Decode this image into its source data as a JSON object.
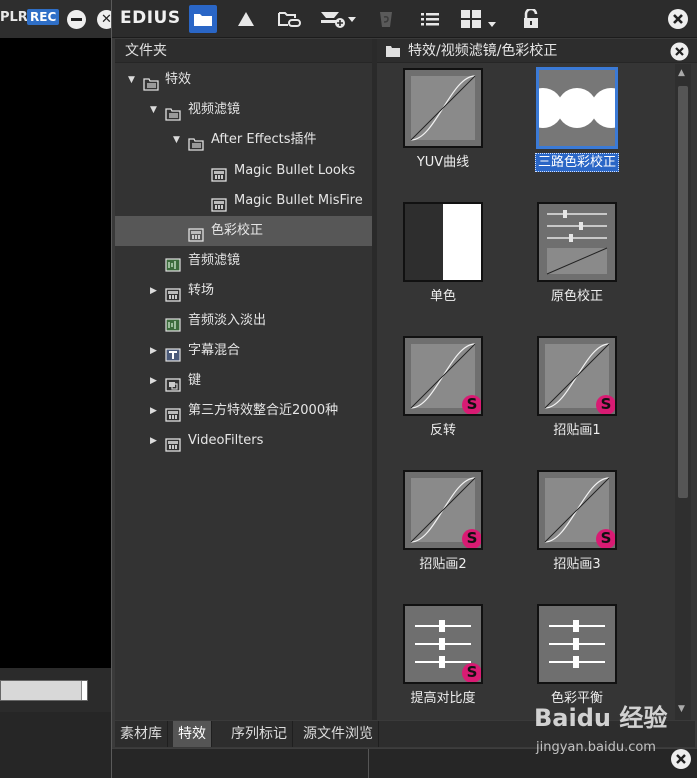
{
  "background_app": {
    "plr_label": "PLR",
    "rec_label": "REC"
  },
  "toolbar": {
    "logo": "EDIUS"
  },
  "tree": {
    "header": "文件夹",
    "items": [
      {
        "label": "特效",
        "arrow": "▼"
      },
      {
        "label": "视频滤镜",
        "arrow": "▼"
      },
      {
        "label": "After Effects插件",
        "arrow": "▼"
      },
      {
        "label": "Magic Bullet Looks",
        "arrow": ""
      },
      {
        "label": "Magic Bullet MisFire",
        "arrow": ""
      },
      {
        "label": "色彩校正",
        "arrow": ""
      },
      {
        "label": "音频滤镜",
        "arrow": ""
      },
      {
        "label": "转场",
        "arrow": "▶"
      },
      {
        "label": "音频淡入淡出",
        "arrow": ""
      },
      {
        "label": "字幕混合",
        "arrow": "▶"
      },
      {
        "label": "键",
        "arrow": "▶"
      },
      {
        "label": "第三方特效整合近2000种",
        "arrow": "▶"
      },
      {
        "label": "VideoFilters",
        "arrow": "▶"
      }
    ]
  },
  "grid": {
    "path": "特效/视频滤镜/色彩校正",
    "tiles": [
      {
        "label": "YUV曲线",
        "badge": ""
      },
      {
        "label": "三路色彩校正",
        "badge": ""
      },
      {
        "label": "单色",
        "badge": ""
      },
      {
        "label": "原色校正",
        "badge": ""
      },
      {
        "label": "反转",
        "badge": "S"
      },
      {
        "label": "招贴画1",
        "badge": "S"
      },
      {
        "label": "招贴画2",
        "badge": "S"
      },
      {
        "label": "招贴画3",
        "badge": "S"
      },
      {
        "label": "提高对比度",
        "badge": "S"
      },
      {
        "label": "色彩平衡",
        "badge": ""
      }
    ]
  },
  "tabs": [
    {
      "label": "素材库"
    },
    {
      "label": "特效"
    },
    {
      "label": "序列标记"
    },
    {
      "label": "源文件浏览"
    }
  ],
  "watermark": {
    "text": "Baidu 经验",
    "url": "jingyan.baidu.com"
  },
  "colors": {
    "accent": "#2a66c6",
    "badge": "#d81b73",
    "panel": "#333333"
  }
}
